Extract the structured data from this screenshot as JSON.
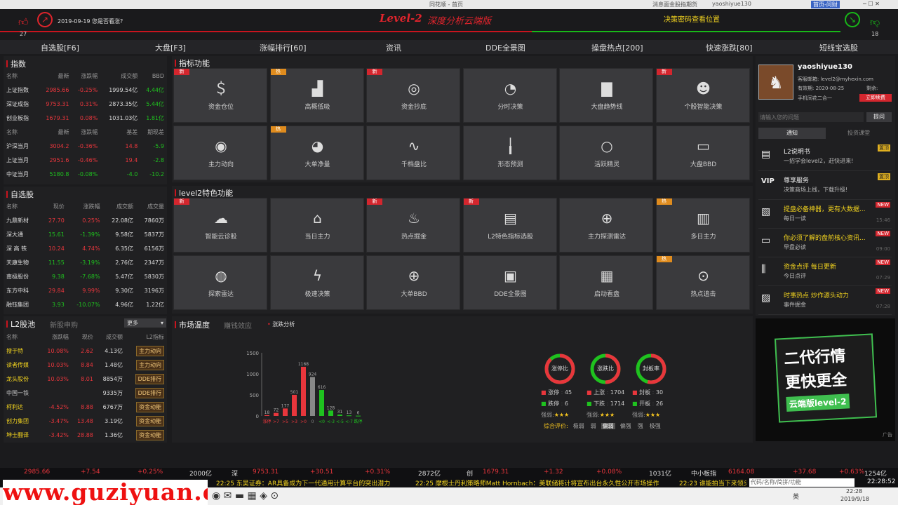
{
  "window_title": "同花顺 - 首页",
  "topbar": {
    "left": "消息面金股指期货",
    "user": "yaoshiyue130",
    "right": "首页-问财"
  },
  "header": {
    "date_text": "2019-09-19 您是否看涨?",
    "brand": "Level-2",
    "subtitle": "深度分析云端版",
    "banner": "决策密码查看位置",
    "likes": "27",
    "dislikes": "18"
  },
  "nav": [
    "自选股[F6]",
    "大盘[F3]",
    "涨幅排行[60]",
    "资讯",
    "DDE全景图",
    "操盘热点[200]",
    "快速涨跌[80]",
    "短线宝选股"
  ],
  "indices": {
    "title": "指数",
    "headers": [
      "名称",
      "最新",
      "涨跌幅",
      "成交额",
      "BBD"
    ],
    "rows": [
      [
        "上证指数",
        "2985.66",
        "-0.25%",
        "1999.54亿",
        "4.44亿"
      ],
      [
        "深证成指",
        "9753.31",
        "0.31%",
        "2873.35亿",
        "5.44亿"
      ],
      [
        "创业板指",
        "1679.31",
        "0.08%",
        "1031.03亿",
        "1.81亿"
      ]
    ],
    "headers2": [
      "名称",
      "最新",
      "涨跌幅",
      "基差",
      "期现差"
    ],
    "rows2": [
      [
        "沪深当月",
        "3004.2",
        "-0.36%",
        "14.8",
        "-5.9"
      ],
      [
        "上证当月",
        "2951.6",
        "-0.46%",
        "19.4",
        "-2.8"
      ],
      [
        "中证当月",
        "5180.8",
        "-0.08%",
        "-4.0",
        "-10.2"
      ]
    ]
  },
  "watchlist": {
    "title": "自选股",
    "headers": [
      "名称",
      "现价",
      "涨跌幅",
      "成交额",
      "成交量"
    ],
    "rows": [
      [
        "九鼎新材",
        "27.70",
        "0.25%",
        "22.08亿",
        "7860万"
      ],
      [
        "深大通",
        "15.61",
        "-1.39%",
        "9.58亿",
        "5837万"
      ],
      [
        "深 高 铁",
        "10.24",
        "4.74%",
        "6.35亿",
        "6156万"
      ],
      [
        "天康生物",
        "11.55",
        "-3.19%",
        "2.76亿",
        "2347万"
      ],
      [
        "南极股份",
        "9.38",
        "-7.68%",
        "5.47亿",
        "5830万"
      ],
      [
        "东方中科",
        "29.84",
        "9.99%",
        "9.30亿",
        "3196万"
      ],
      [
        "融钰集团",
        "3.93",
        "-10.07%",
        "4.96亿",
        "1.22亿"
      ]
    ]
  },
  "l2pool": {
    "tabs": [
      "L2股池",
      "新股申购"
    ],
    "more": "更多",
    "headers": [
      "名称",
      "涨跌幅",
      "现价",
      "成交额",
      "L2指标"
    ],
    "rows": [
      [
        "搜于特",
        "10.08%",
        "2.62",
        "4.13亿",
        "主力动向"
      ],
      [
        "读者传媒",
        "10.03%",
        "8.84",
        "1.48亿",
        "主力动向"
      ],
      [
        "龙头股份",
        "10.03%",
        "8.01",
        "8854万",
        "DDE排行"
      ],
      [
        "中国一铁",
        "",
        "",
        "9335万",
        "DDE排行"
      ],
      [
        "柯利达",
        "-4.52%",
        "8.88",
        "6767万",
        "资金动能"
      ],
      [
        "创力集团",
        "-3.47%",
        "13.48",
        "3.19亿",
        "资金动能"
      ],
      [
        "坤士翻译",
        "-3.42%",
        "28.88",
        "1.36亿",
        "资金动能"
      ]
    ]
  },
  "indicator_section": {
    "title": "指标功能",
    "tiles": [
      {
        "label": "资金仓位",
        "icon": "money-bag-icon",
        "glyph": "＄",
        "tag": "新"
      },
      {
        "label": "高概低吸",
        "icon": "area-chart-icon",
        "glyph": "▟",
        "tag": "热"
      },
      {
        "label": "资金抄底",
        "icon": "coins-icon",
        "glyph": "◎",
        "tag": "新"
      },
      {
        "label": "分时决策",
        "icon": "target-icon",
        "glyph": "◔",
        "tag": ""
      },
      {
        "label": "大盘趋势线",
        "icon": "trend-chart-icon",
        "glyph": "▇",
        "tag": ""
      },
      {
        "label": "个股智能决策",
        "icon": "brain-icon",
        "glyph": "☻",
        "tag": "新"
      },
      {
        "label": "主力动向",
        "icon": "eye-icon",
        "glyph": "◉",
        "tag": ""
      },
      {
        "label": "大单净量",
        "icon": "pie-icon",
        "glyph": "◕",
        "tag": "热"
      },
      {
        "label": "千档盘比",
        "icon": "wave-icon",
        "glyph": "∿",
        "tag": ""
      },
      {
        "label": "形态预测",
        "icon": "candles-icon",
        "glyph": "╽",
        "tag": ""
      },
      {
        "label": "活跃精灵",
        "icon": "search-icon",
        "glyph": "○",
        "tag": ""
      },
      {
        "label": "大盘BBD",
        "icon": "bbd-icon",
        "glyph": "▭",
        "tag": ""
      }
    ]
  },
  "l2_section": {
    "title": "level2特色功能",
    "tiles": [
      {
        "label": "智能云诊股",
        "icon": "cloud-icon",
        "glyph": "☁",
        "tag": "新"
      },
      {
        "label": "当日主力",
        "icon": "bank-icon",
        "glyph": "⌂",
        "tag": ""
      },
      {
        "label": "热点掘金",
        "icon": "fire-icon",
        "glyph": "♨",
        "tag": "新"
      },
      {
        "label": "L2特色指标选股",
        "icon": "doc-icon",
        "glyph": "▤",
        "tag": "新"
      },
      {
        "label": "主力探测雷达",
        "icon": "radar-icon",
        "glyph": "⊕",
        "tag": ""
      },
      {
        "label": "多日主力",
        "icon": "bars-icon",
        "glyph": "▥",
        "tag": "热"
      },
      {
        "label": "探索雷达",
        "icon": "satellite-icon",
        "glyph": "◍",
        "tag": ""
      },
      {
        "label": "极速决策",
        "icon": "lightning-icon",
        "glyph": "ϟ",
        "tag": ""
      },
      {
        "label": "大单BBD",
        "icon": "crosshair-icon",
        "glyph": "⊕",
        "tag": ""
      },
      {
        "label": "DDE全景图",
        "icon": "dde-icon",
        "glyph": "▣",
        "tag": ""
      },
      {
        "label": "启动看盘",
        "icon": "launch-icon",
        "glyph": "▦",
        "tag": ""
      },
      {
        "label": "热点追击",
        "icon": "aim-icon",
        "glyph": "⊙",
        "tag": "热"
      }
    ]
  },
  "market": {
    "title": "市场温度",
    "tabs": [
      "赚钱效应",
      "涨跌分析"
    ],
    "legend": [
      "涨停",
      "涨跌停",
      "跌停"
    ],
    "stat1": {
      "label1": "涨停",
      "value1": "45",
      "label2": "跌停",
      "value2": "6"
    },
    "stat2": {
      "label1": "上涨",
      "value1": "1704",
      "label2": "下跌",
      "value2": "1714"
    },
    "stat3": {
      "label1": "封板",
      "value1": "30",
      "label2": "开板",
      "value2": "26"
    },
    "rings": [
      "涨停比",
      "涨跌比",
      "封板率"
    ],
    "rings_pct": [
      0.88,
      0.5,
      0.54
    ],
    "rating_labels": [
      "强弱:",
      "强弱:",
      "强弱:"
    ],
    "stars": "★★★",
    "summary": {
      "label": "综合评价:",
      "levels": [
        "极弱",
        "弱",
        "偏弱",
        "偏强",
        "强",
        "极强"
      ]
    }
  },
  "chart_data": {
    "type": "bar",
    "categories": [
      "涨停",
      ">7",
      ">5",
      ">3",
      ">0",
      "0",
      "<0",
      "<-3",
      "<-5",
      "<-7",
      "跌停"
    ],
    "values": [
      18,
      72,
      177,
      501,
      1168,
      924,
      616,
      128,
      31,
      13,
      6
    ],
    "colors": [
      "red",
      "red",
      "red",
      "red",
      "red",
      "grey",
      "green",
      "green",
      "green",
      "green",
      "green"
    ],
    "ylim": [
      0,
      1500
    ],
    "yticks": [
      "1500",
      "1000",
      "500",
      "0"
    ]
  },
  "right_panel": {
    "username": "yaoshiyue130",
    "email": "客服邮箱: level2@myhexin.com",
    "expiry": "有效期: 2020-08-25",
    "remain": "剩余:",
    "tip": "手机同花二合一",
    "renew": "立即续费",
    "search_placeholder": "请输入您的问题",
    "search_btn": "提问",
    "tabs": [
      "通知",
      "投资课堂"
    ],
    "notices": [
      {
        "title": "L2说明书",
        "desc": "一招学会level2，赶快进来!",
        "badge": "置顶",
        "time": "",
        "icon": "book-icon",
        "glyph": "▤"
      },
      {
        "title": "尊享服务",
        "desc": "决策商场上线，下载升级!",
        "badge": "置顶",
        "time": "",
        "icon": "vip-icon",
        "glyph": "VIP"
      },
      {
        "title": "提盘必备神器，更有大数据...",
        "desc": "每日一读",
        "badge": "NEW",
        "time": "15:46",
        "icon": "chart-doc-icon",
        "glyph": "▧"
      },
      {
        "title": "你必须了解的盘前核心资讯...",
        "desc": "早盘必读",
        "badge": "NEW",
        "time": "09:00",
        "icon": "chat-icon",
        "glyph": "▭"
      },
      {
        "title": "资金点评 每日更新",
        "desc": "今日点评",
        "badge": "NEW",
        "time": "07:29",
        "icon": "sliders-icon",
        "glyph": "⫼"
      },
      {
        "title": "时事热点 炒作源头动力",
        "desc": "事件掘金",
        "badge": "NEW",
        "time": "07:28",
        "icon": "news-icon",
        "glyph": "▨"
      }
    ]
  },
  "ad": {
    "line1": "二代行情",
    "line2": "更快更全",
    "line3": "云端版level-2",
    "corner": "广告"
  },
  "ticker": [
    [
      "2985.66",
      "r"
    ],
    [
      "+7.54",
      "r"
    ],
    [
      "+0.25%",
      "r"
    ],
    [
      "2000亿",
      "w"
    ],
    [
      "深",
      "w"
    ],
    [
      "9753.31",
      "r"
    ],
    [
      "+30.51",
      "r"
    ],
    [
      "+0.31%",
      "r"
    ],
    [
      "2872亿",
      "w"
    ],
    [
      "创",
      "w"
    ],
    [
      "1679.31",
      "r"
    ],
    [
      "+1.32",
      "r"
    ],
    [
      "+0.08%",
      "r"
    ],
    [
      "1031亿",
      "w"
    ],
    [
      "中小板指",
      "w"
    ],
    [
      "6164.08",
      "r"
    ],
    [
      "+37.68",
      "r"
    ],
    [
      "+0.63%",
      "r"
    ],
    [
      "1254亿",
      "w"
    ]
  ],
  "news": [
    "22:25 东吴证券：AR具备成为下一代通用计算平台的突出潜力",
    "22:25 摩根士丹利策略师Matt Hornbach：美联储将计将宣布出台永久性公开市场操作",
    "22:23 谁能拍当下来领头羊？消费电..."
  ],
  "news_clock": "22:28:52",
  "watermark": "www.guziyuan.cn",
  "taskbar": {
    "time": "22:28",
    "date": "2019/9/18",
    "lang": "英",
    "search": "代码/名称/简拼/功能"
  }
}
